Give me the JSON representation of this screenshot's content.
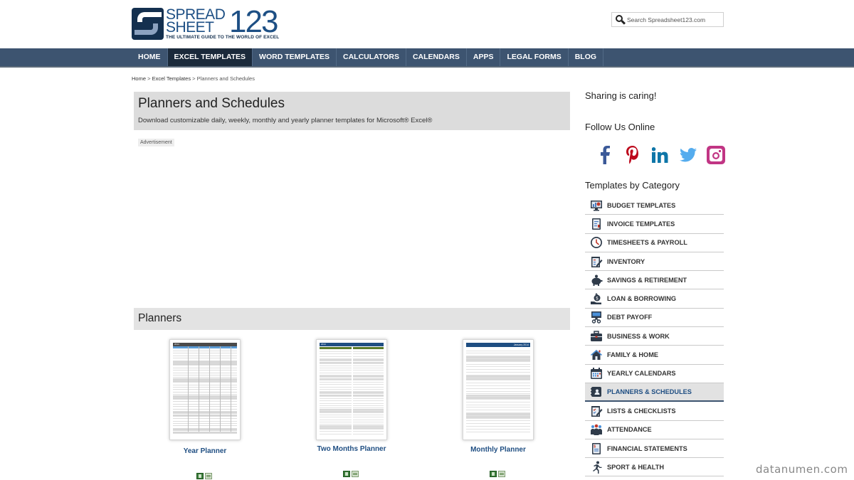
{
  "site": {
    "logo_word1": "SPREAD",
    "logo_word2": "SHEET",
    "logo_number": "123",
    "logo_tagline": "THE ULTIMATE GUIDE TO THE WORLD OF EXCEL",
    "search_placeholder": "Search Spreadsheet123.com"
  },
  "nav": {
    "items": [
      {
        "label": "HOME",
        "active": false
      },
      {
        "label": "EXCEL TEMPLATES",
        "active": true
      },
      {
        "label": "WORD TEMPLATES",
        "active": false
      },
      {
        "label": "CALCULATORS",
        "active": false
      },
      {
        "label": "CALENDARS",
        "active": false
      },
      {
        "label": "APPS",
        "active": false
      },
      {
        "label": "LEGAL FORMS",
        "active": false
      },
      {
        "label": "BLOG",
        "active": false
      }
    ]
  },
  "breadcrumb": {
    "items": [
      "Home",
      "Excel Templates",
      "Planners and Schedules"
    ],
    "separator": ">"
  },
  "page": {
    "title": "Planners and Schedules",
    "subtitle": "Download customizable daily, weekly, monthly and yearly planner templates for Microsoft® Excel®",
    "ad_label": "Advertisement"
  },
  "section": {
    "title": "Planners",
    "cards": [
      {
        "title": "Year Planner",
        "thumb_header": "2014",
        "header_color": "#4a4a4a",
        "accent_color": "#5b9bd5"
      },
      {
        "title": "Two Months Planner",
        "thumb_header": "2014",
        "header_color": "#1f4e82",
        "accent_color": "#5a7a2a"
      },
      {
        "title": "Monthly Planner",
        "thumb_header": "January 2014",
        "header_color": "#1f4e82",
        "accent_color": "#1f4e82"
      }
    ]
  },
  "sidebar": {
    "sharing_heading": "Sharing is caring!",
    "follow_heading": "Follow Us Online",
    "social": [
      {
        "name": "facebook",
        "color": "#3b5998"
      },
      {
        "name": "pinterest",
        "color": "#bd081c"
      },
      {
        "name": "linkedin",
        "color": "#0e76a8"
      },
      {
        "name": "twitter",
        "color": "#55acee"
      },
      {
        "name": "instagram",
        "color": "#c13584"
      }
    ],
    "categories_heading": "Templates by Category",
    "categories": [
      {
        "label": "BUDGET TEMPLATES",
        "icon": "monitor-chart-icon",
        "active": false
      },
      {
        "label": "INVOICE TEMPLATES",
        "icon": "invoice-icon",
        "active": false
      },
      {
        "label": "TIMESHEETS & PAYROLL",
        "icon": "clock-icon",
        "active": false
      },
      {
        "label": "INVENTORY",
        "icon": "clipboard-pencil-icon",
        "active": false
      },
      {
        "label": "SAVINGS & RETIREMENT",
        "icon": "piggy-bank-icon",
        "active": false
      },
      {
        "label": "LOAN & BORROWING",
        "icon": "money-bag-hand-icon",
        "active": false
      },
      {
        "label": "DEBT PAYOFF",
        "icon": "scissors-card-icon",
        "active": false
      },
      {
        "label": "BUSINESS & WORK",
        "icon": "briefcase-icon",
        "active": false
      },
      {
        "label": "FAMILY & HOME",
        "icon": "house-icon",
        "active": false
      },
      {
        "label": "YEARLY CALENDARS",
        "icon": "calendar-icon",
        "active": false
      },
      {
        "label": "PLANNERS & SCHEDULES",
        "icon": "planner-book-icon",
        "active": true
      },
      {
        "label": "LISTS & CHECKLISTS",
        "icon": "checklist-icon",
        "active": false
      },
      {
        "label": "ATTENDANCE",
        "icon": "people-group-icon",
        "active": false
      },
      {
        "label": "FINANCIAL STATEMENTS",
        "icon": "statement-doc-icon",
        "active": false
      },
      {
        "label": "SPORT & HEALTH",
        "icon": "runner-icon",
        "active": false
      }
    ]
  },
  "watermark": "datanumen.com"
}
